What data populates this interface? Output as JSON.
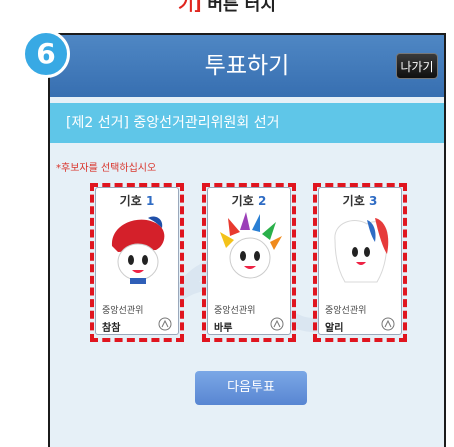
{
  "instruction": {
    "highlight_text": "기]",
    "rest_text": " 버튼 터치"
  },
  "step_number": "6",
  "header": {
    "title": "투표하기",
    "exit_label": "나가기"
  },
  "election_title": "[제2 선거] 중앙선거관리위원회 선거",
  "notice": "*후보자를 선택하십시오",
  "candidates": [
    {
      "symbol_label": "기호",
      "number": "1",
      "party": "중앙선관위",
      "name": "참참"
    },
    {
      "symbol_label": "기호",
      "number": "2",
      "party": "중앙선관위",
      "name": "바루"
    },
    {
      "symbol_label": "기호",
      "number": "3",
      "party": "중앙선관위",
      "name": "알리"
    }
  ],
  "next_button": "다음투표",
  "colors": {
    "header": "#376fb1",
    "election_bar": "#5fc6e8",
    "highlight": "#e0151f",
    "step_circle": "#38a9e4"
  }
}
